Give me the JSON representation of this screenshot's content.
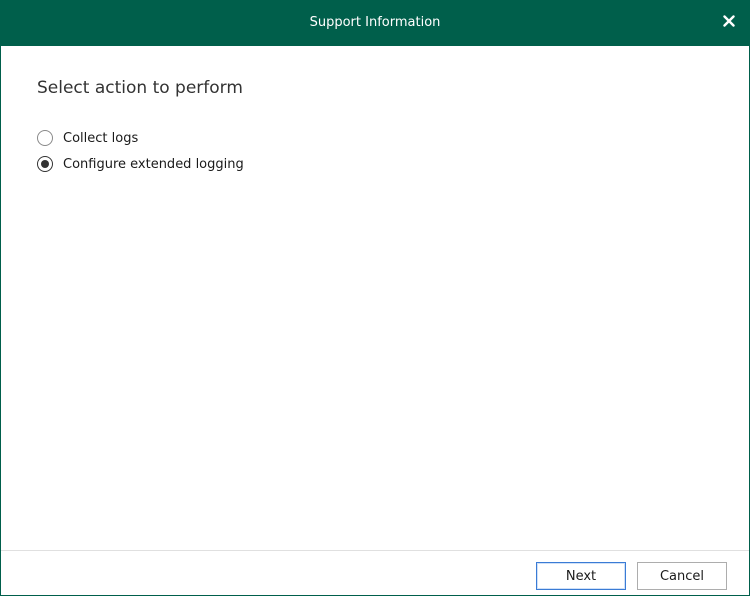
{
  "window": {
    "title": "Support Information",
    "close_icon": "close-icon"
  },
  "main": {
    "heading": "Select action to perform",
    "options": [
      {
        "label": "Collect logs",
        "selected": false
      },
      {
        "label": "Configure extended logging",
        "selected": true
      }
    ]
  },
  "footer": {
    "next_label": "Next",
    "cancel_label": "Cancel"
  },
  "colors": {
    "titlebar": "#005f4b",
    "title_text": "#ffffff",
    "focus_border": "#3a7bd5"
  }
}
